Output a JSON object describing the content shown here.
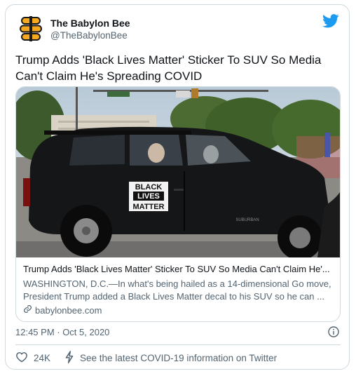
{
  "account": {
    "name": "The Babylon Bee",
    "handle": "@TheBabylonBee",
    "avatar_icon": "bee-logo-icon",
    "platform_icon": "twitter-bird-icon"
  },
  "tweet": {
    "text": "Trump Adds 'Black Lives Matter' Sticker To SUV So Media Can't Claim He's Spreading COVID",
    "timestamp": "12:45 PM · Oct 5, 2020"
  },
  "link_card": {
    "image": {
      "sticker_line1": "BLACK",
      "sticker_line2": "LIVES",
      "sticker_line3": "MATTER",
      "vehicle_badge": "SUBURBAN",
      "icon": "suv-photo"
    },
    "title": "Trump Adds 'Black Lives Matter' Sticker To SUV So Media Can't Claim He'...",
    "description": "WASHINGTON, D.C.—In what's being hailed as a 14-dimensional Go move, President Trump added a Black Lives Matter decal to his SUV so he can ...",
    "domain": "babylonbee.com"
  },
  "actions": {
    "likes": "24K",
    "covid_info": "See the latest COVID-19 information on Twitter"
  },
  "colors": {
    "twitter_blue": "#1d9bf0",
    "text_primary": "#0f1419",
    "text_secondary": "#536471",
    "border": "#cfd9de"
  }
}
